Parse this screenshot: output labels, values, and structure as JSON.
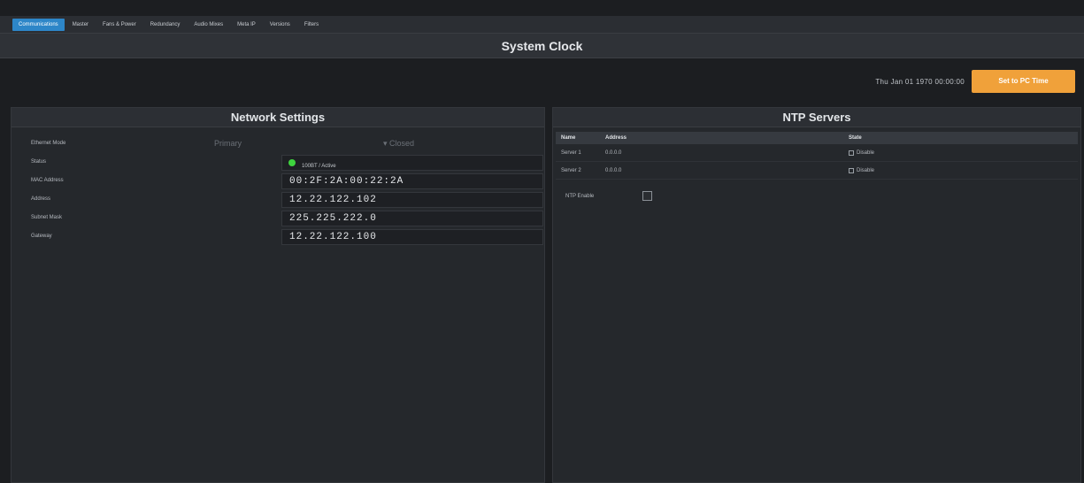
{
  "tabs": [
    {
      "label": "Communications",
      "active": true
    },
    {
      "label": "Master"
    },
    {
      "label": "Fans & Power"
    },
    {
      "label": "Redundancy"
    },
    {
      "label": "Audio Mixes"
    },
    {
      "label": "Meta IP"
    },
    {
      "label": "Versions"
    },
    {
      "label": "Filters"
    }
  ],
  "system_clock": {
    "title": "System Clock",
    "current_time": "Thu Jan 01 1970 00:00:00",
    "set_pc_time_label": "Set to PC Time"
  },
  "network": {
    "title": "Network Settings",
    "rows": {
      "ethernet_mode": {
        "label": "Ethernet Mode",
        "primary": "Primary",
        "closed": "▾ Closed"
      },
      "status": {
        "label": "Status",
        "value": "100BT / Active"
      },
      "mac": {
        "label": "MAC Address",
        "value": "00:2F:2A:00:22:2A"
      },
      "address": {
        "label": "Address",
        "value": "12.22.122.102"
      },
      "subnet": {
        "label": "Subnet Mask",
        "value": "225.225.222.0"
      },
      "gateway": {
        "label": "Gateway",
        "value": "12.22.122.100"
      }
    },
    "status_color": "#3ed33e"
  },
  "ntp": {
    "title": "NTP Servers",
    "columns": {
      "name": "Name",
      "address": "Address",
      "state": "State"
    },
    "servers": [
      {
        "name": "Server 1",
        "address": "0.0.0.0",
        "state": "Disable"
      },
      {
        "name": "Server 2",
        "address": "0.0.0.0",
        "state": "Disable"
      }
    ],
    "enable_label": "NTP Enable"
  },
  "colors": {
    "accent": "#2d86c8",
    "button": "#f0a13a",
    "background": "#1c1e21"
  }
}
